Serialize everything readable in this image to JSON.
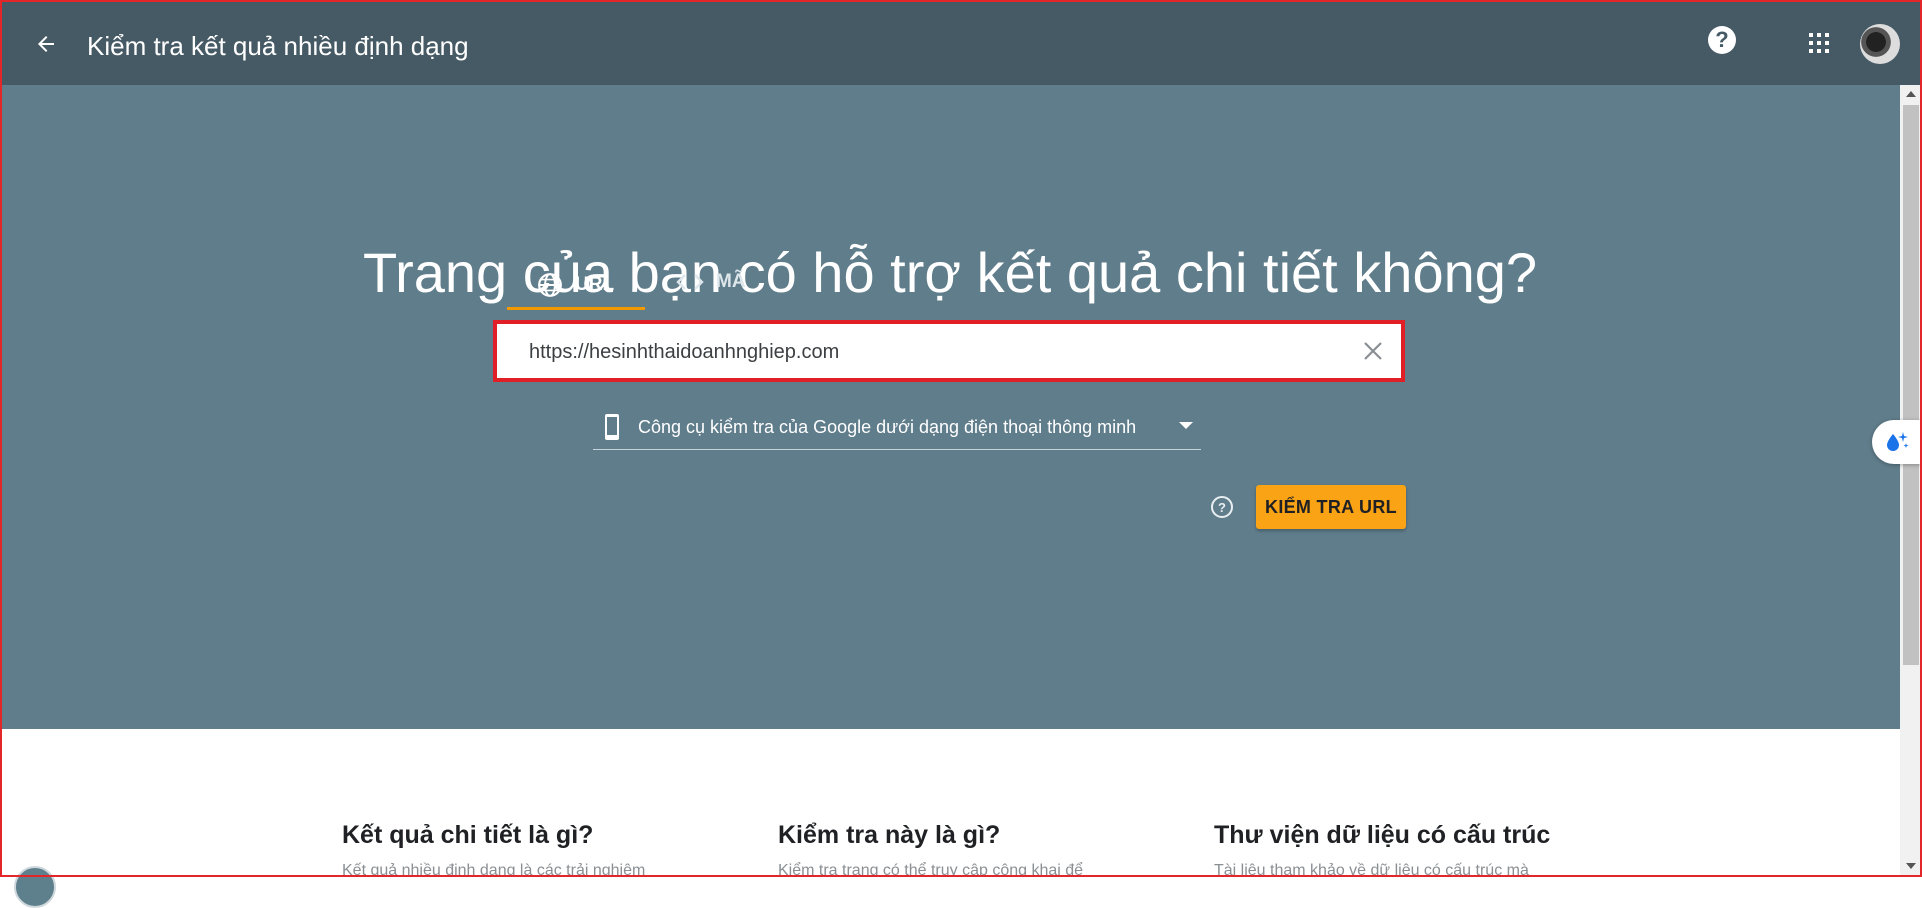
{
  "header": {
    "title": "Kiểm tra kết quả nhiều định dạng",
    "back_icon": "arrow-back-icon",
    "help_icon": "help-icon",
    "apps_icon": "apps-grid-icon"
  },
  "hero": {
    "heading": "Trang của bạn có hỗ trợ kết quả chi tiết không?",
    "tabs": [
      {
        "label": "URL",
        "icon": "globe-icon",
        "active": true
      },
      {
        "label": "MÃ",
        "icon": "code-icon",
        "active": false
      }
    ],
    "url_input": {
      "value": "https://hesinhthaidoanhnghiep.com",
      "placeholder": ""
    },
    "agent_select": {
      "selected": "Công cụ kiểm tra của Google dưới dạng điện thoại thông minh"
    },
    "check_button": "KIỂM TRA URL"
  },
  "sections": [
    {
      "title": "Kết quả chi tiết là gì?",
      "text": "Kết quả nhiều định dạng là các trải nghiệm"
    },
    {
      "title": "Kiểm tra này là gì?",
      "text": "Kiểm tra trang có thể truy cập công khai để"
    },
    {
      "title": "Thư viện dữ liệu có cấu trúc",
      "text": "Tài liệu tham khảo về dữ liệu có cấu trúc mà"
    }
  ],
  "colors": {
    "appbar": "#465a65",
    "hero": "#607d8b",
    "accent": "#f29900",
    "button": "#f9a315",
    "highlight": "#e01f26"
  }
}
